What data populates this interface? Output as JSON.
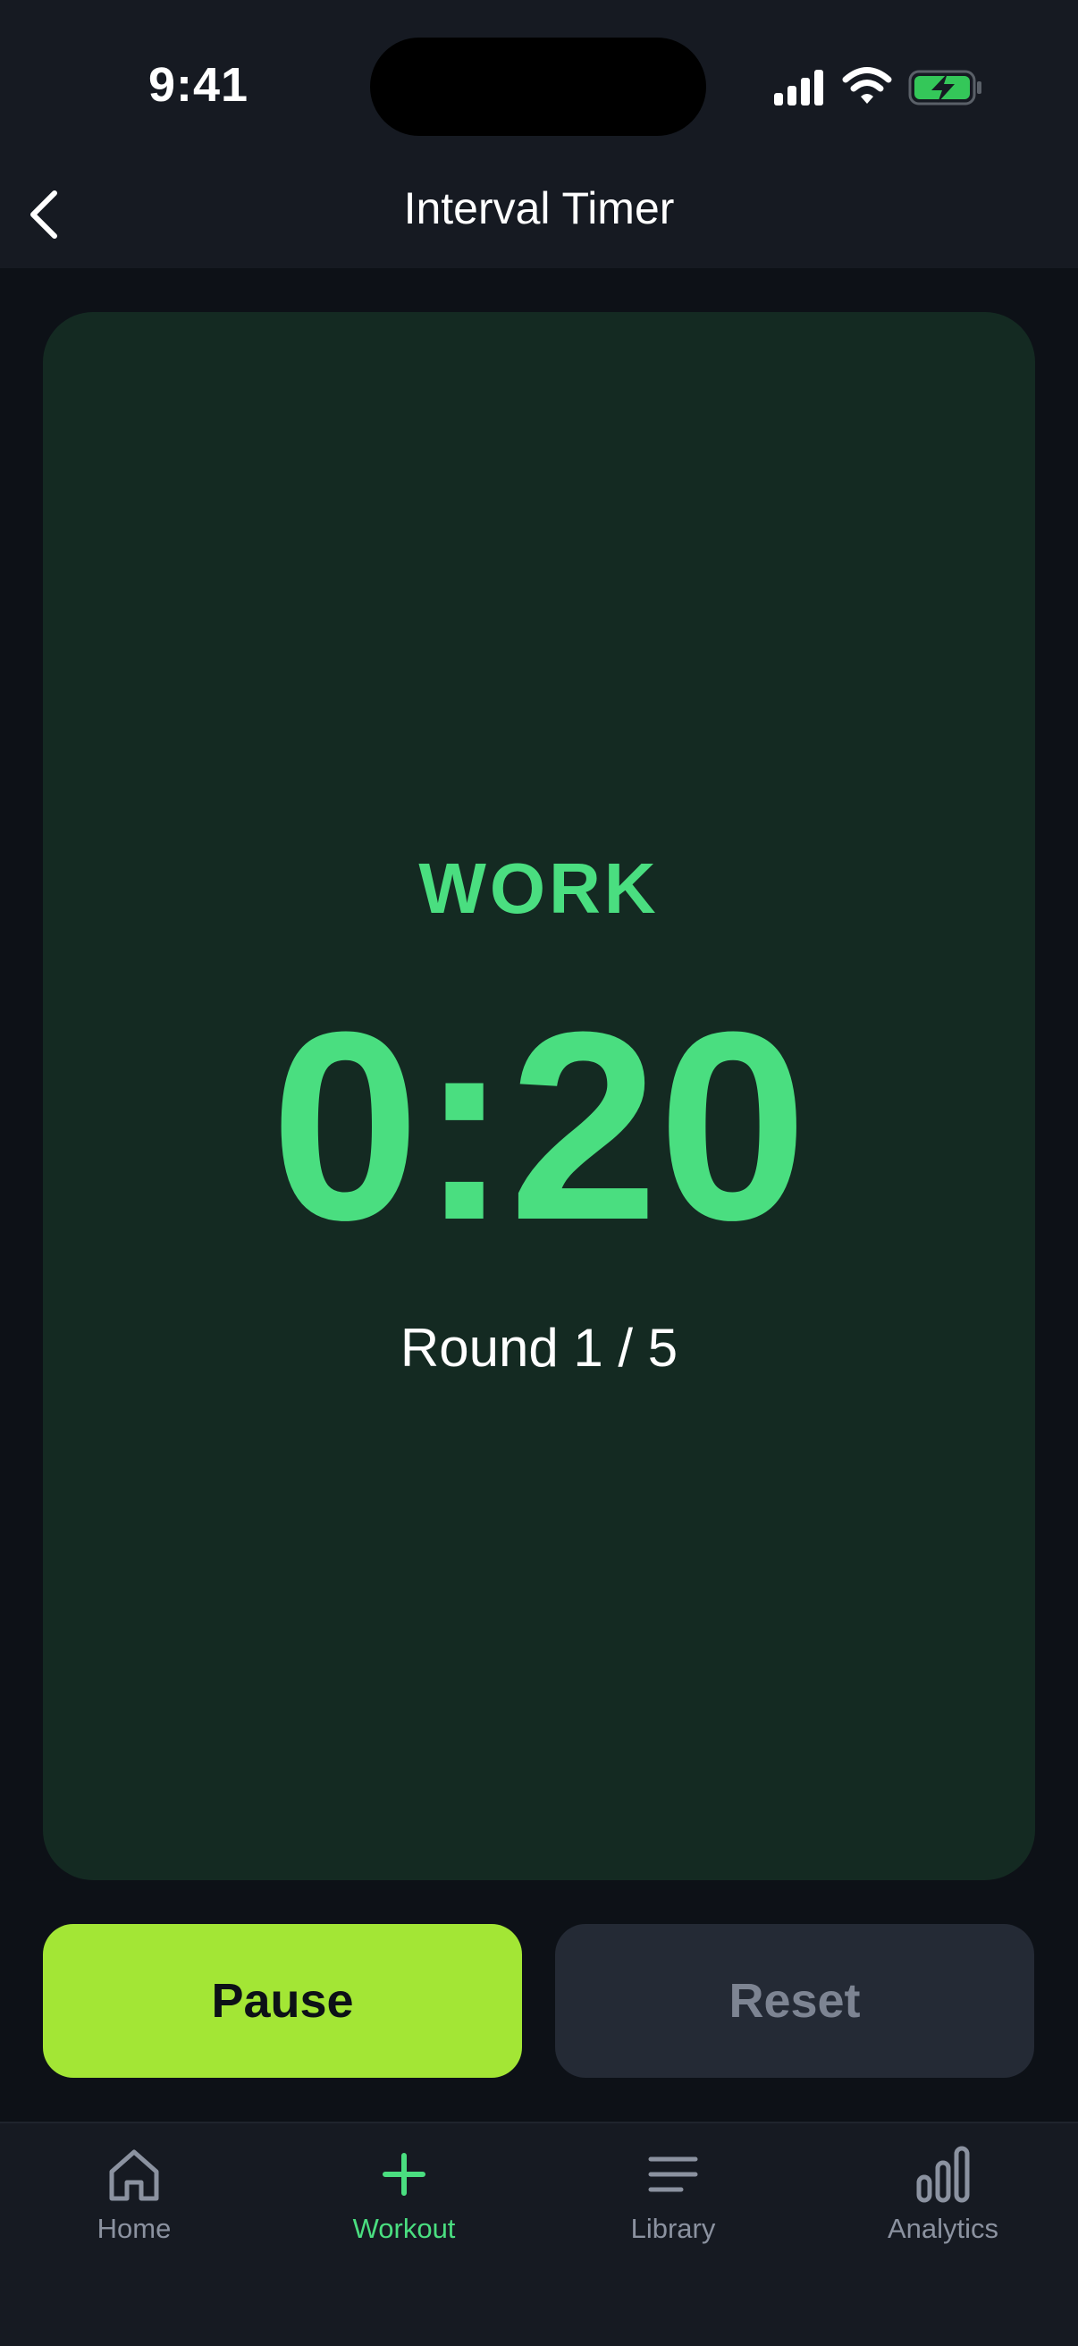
{
  "status_bar": {
    "time": "9:41",
    "icons": [
      "signal-icon",
      "wifi-icon",
      "battery-charging-icon"
    ]
  },
  "nav": {
    "back_icon": "chevron-left-icon",
    "title": "Interval Timer"
  },
  "timer": {
    "phase": "WORK",
    "time": "0:20",
    "round": "Round 1 / 5"
  },
  "actions": {
    "pause_label": "Pause",
    "reset_label": "Reset"
  },
  "tabs": [
    {
      "label": "Home",
      "icon": "home-icon",
      "active": false
    },
    {
      "label": "Workout",
      "icon": "plus-icon",
      "active": true
    },
    {
      "label": "Library",
      "icon": "list-icon",
      "active": false
    },
    {
      "label": "Analytics",
      "icon": "bar-chart-icon",
      "active": false
    }
  ],
  "colors": {
    "accent_green": "#4ade80",
    "pause_button": "#a3e635",
    "card_background": "#142a22",
    "page_background": "#0d1117",
    "bar_background": "#161a22",
    "reset_button": "#242a35",
    "muted_text": "#8b92a0"
  }
}
